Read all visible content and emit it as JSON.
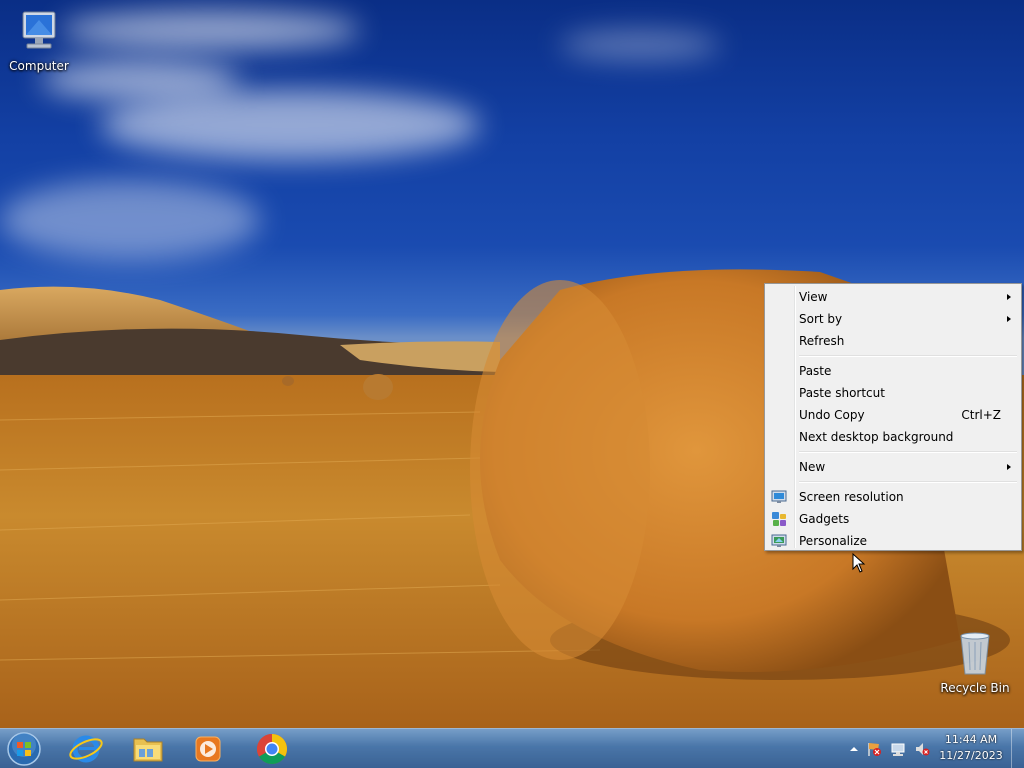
{
  "desktop": {
    "icons": {
      "computer": {
        "label": "Computer",
        "icon": "computer-icon"
      },
      "recycle_bin": {
        "label": "Recycle Bin",
        "icon": "recycle-bin-icon"
      }
    }
  },
  "context_menu": {
    "view": "View",
    "sort_by": "Sort by",
    "refresh": "Refresh",
    "paste": "Paste",
    "paste_shortcut": "Paste shortcut",
    "undo_copy": "Undo Copy",
    "undo_copy_shortcut": "Ctrl+Z",
    "next_background": "Next desktop background",
    "new": "New",
    "screen_resolution": "Screen resolution",
    "gadgets": "Gadgets",
    "personalize": "Personalize"
  },
  "taskbar": {
    "apps": [
      "internet-explorer-icon",
      "windows-explorer-icon",
      "media-player-icon",
      "chrome-icon"
    ],
    "clock": {
      "time": "11:44 AM",
      "date": "11/27/2023"
    }
  },
  "colors": {
    "menu_bg": "#f0f0f0",
    "menu_border": "#979797",
    "taskbar": "#4a7fb4"
  }
}
